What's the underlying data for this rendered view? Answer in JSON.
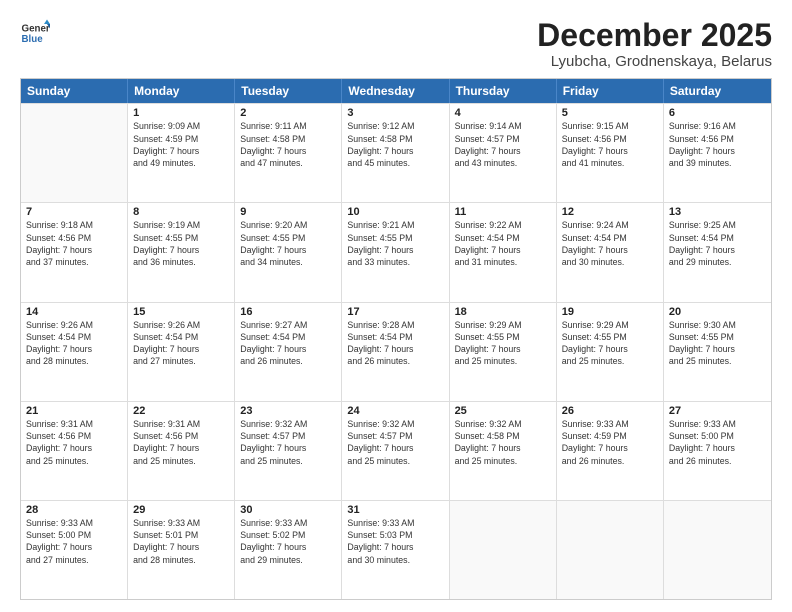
{
  "header": {
    "logo_line1": "General",
    "logo_line2": "Blue",
    "month": "December 2025",
    "location": "Lyubcha, Grodnenskaya, Belarus"
  },
  "weekdays": [
    "Sunday",
    "Monday",
    "Tuesday",
    "Wednesday",
    "Thursday",
    "Friday",
    "Saturday"
  ],
  "rows": [
    [
      {
        "day": "",
        "info": ""
      },
      {
        "day": "1",
        "info": "Sunrise: 9:09 AM\nSunset: 4:59 PM\nDaylight: 7 hours\nand 49 minutes."
      },
      {
        "day": "2",
        "info": "Sunrise: 9:11 AM\nSunset: 4:58 PM\nDaylight: 7 hours\nand 47 minutes."
      },
      {
        "day": "3",
        "info": "Sunrise: 9:12 AM\nSunset: 4:58 PM\nDaylight: 7 hours\nand 45 minutes."
      },
      {
        "day": "4",
        "info": "Sunrise: 9:14 AM\nSunset: 4:57 PM\nDaylight: 7 hours\nand 43 minutes."
      },
      {
        "day": "5",
        "info": "Sunrise: 9:15 AM\nSunset: 4:56 PM\nDaylight: 7 hours\nand 41 minutes."
      },
      {
        "day": "6",
        "info": "Sunrise: 9:16 AM\nSunset: 4:56 PM\nDaylight: 7 hours\nand 39 minutes."
      }
    ],
    [
      {
        "day": "7",
        "info": "Sunrise: 9:18 AM\nSunset: 4:56 PM\nDaylight: 7 hours\nand 37 minutes."
      },
      {
        "day": "8",
        "info": "Sunrise: 9:19 AM\nSunset: 4:55 PM\nDaylight: 7 hours\nand 36 minutes."
      },
      {
        "day": "9",
        "info": "Sunrise: 9:20 AM\nSunset: 4:55 PM\nDaylight: 7 hours\nand 34 minutes."
      },
      {
        "day": "10",
        "info": "Sunrise: 9:21 AM\nSunset: 4:55 PM\nDaylight: 7 hours\nand 33 minutes."
      },
      {
        "day": "11",
        "info": "Sunrise: 9:22 AM\nSunset: 4:54 PM\nDaylight: 7 hours\nand 31 minutes."
      },
      {
        "day": "12",
        "info": "Sunrise: 9:24 AM\nSunset: 4:54 PM\nDaylight: 7 hours\nand 30 minutes."
      },
      {
        "day": "13",
        "info": "Sunrise: 9:25 AM\nSunset: 4:54 PM\nDaylight: 7 hours\nand 29 minutes."
      }
    ],
    [
      {
        "day": "14",
        "info": "Sunrise: 9:26 AM\nSunset: 4:54 PM\nDaylight: 7 hours\nand 28 minutes."
      },
      {
        "day": "15",
        "info": "Sunrise: 9:26 AM\nSunset: 4:54 PM\nDaylight: 7 hours\nand 27 minutes."
      },
      {
        "day": "16",
        "info": "Sunrise: 9:27 AM\nSunset: 4:54 PM\nDaylight: 7 hours\nand 26 minutes."
      },
      {
        "day": "17",
        "info": "Sunrise: 9:28 AM\nSunset: 4:54 PM\nDaylight: 7 hours\nand 26 minutes."
      },
      {
        "day": "18",
        "info": "Sunrise: 9:29 AM\nSunset: 4:55 PM\nDaylight: 7 hours\nand 25 minutes."
      },
      {
        "day": "19",
        "info": "Sunrise: 9:29 AM\nSunset: 4:55 PM\nDaylight: 7 hours\nand 25 minutes."
      },
      {
        "day": "20",
        "info": "Sunrise: 9:30 AM\nSunset: 4:55 PM\nDaylight: 7 hours\nand 25 minutes."
      }
    ],
    [
      {
        "day": "21",
        "info": "Sunrise: 9:31 AM\nSunset: 4:56 PM\nDaylight: 7 hours\nand 25 minutes."
      },
      {
        "day": "22",
        "info": "Sunrise: 9:31 AM\nSunset: 4:56 PM\nDaylight: 7 hours\nand 25 minutes."
      },
      {
        "day": "23",
        "info": "Sunrise: 9:32 AM\nSunset: 4:57 PM\nDaylight: 7 hours\nand 25 minutes."
      },
      {
        "day": "24",
        "info": "Sunrise: 9:32 AM\nSunset: 4:57 PM\nDaylight: 7 hours\nand 25 minutes."
      },
      {
        "day": "25",
        "info": "Sunrise: 9:32 AM\nSunset: 4:58 PM\nDaylight: 7 hours\nand 25 minutes."
      },
      {
        "day": "26",
        "info": "Sunrise: 9:33 AM\nSunset: 4:59 PM\nDaylight: 7 hours\nand 26 minutes."
      },
      {
        "day": "27",
        "info": "Sunrise: 9:33 AM\nSunset: 5:00 PM\nDaylight: 7 hours\nand 26 minutes."
      }
    ],
    [
      {
        "day": "28",
        "info": "Sunrise: 9:33 AM\nSunset: 5:00 PM\nDaylight: 7 hours\nand 27 minutes."
      },
      {
        "day": "29",
        "info": "Sunrise: 9:33 AM\nSunset: 5:01 PM\nDaylight: 7 hours\nand 28 minutes."
      },
      {
        "day": "30",
        "info": "Sunrise: 9:33 AM\nSunset: 5:02 PM\nDaylight: 7 hours\nand 29 minutes."
      },
      {
        "day": "31",
        "info": "Sunrise: 9:33 AM\nSunset: 5:03 PM\nDaylight: 7 hours\nand 30 minutes."
      },
      {
        "day": "",
        "info": ""
      },
      {
        "day": "",
        "info": ""
      },
      {
        "day": "",
        "info": ""
      }
    ]
  ]
}
